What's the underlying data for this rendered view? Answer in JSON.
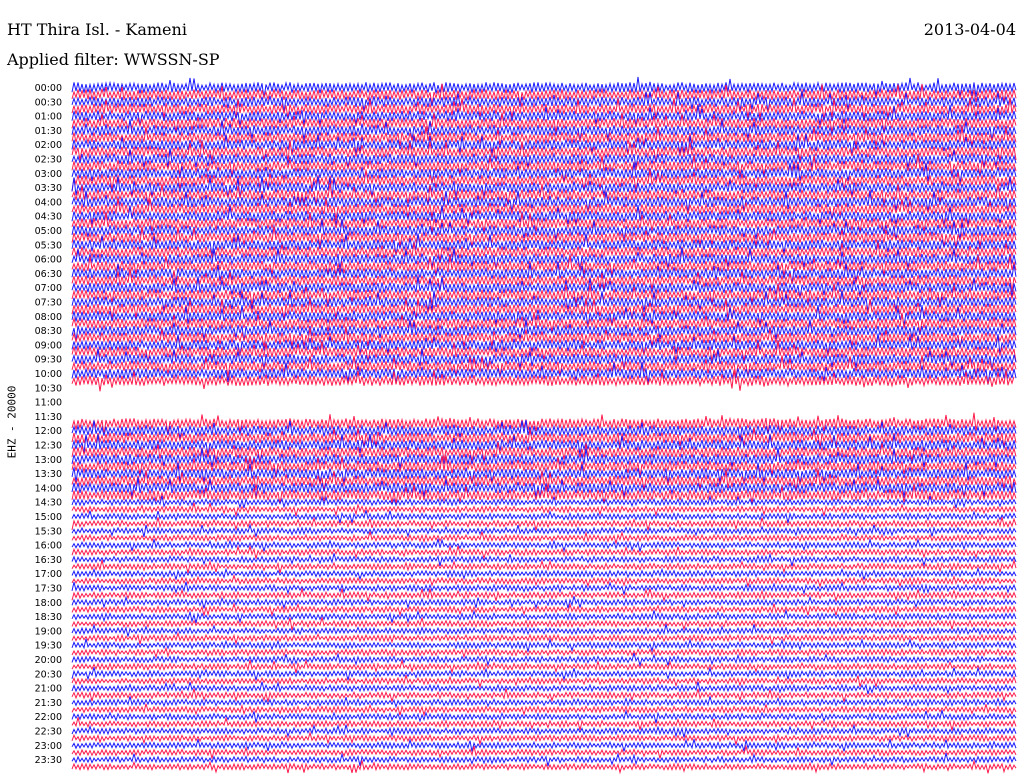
{
  "header": {
    "station": "HT Thira Isl. - Kameni",
    "date": "2013-04-04",
    "filter": "Applied filter: WWSSN-SP",
    "channel": "EHZ - 20000"
  },
  "chart_data": {
    "type": "line",
    "chart_kind": "helicorder (seismogram drum plot)",
    "station": "HT Thira Isl. - Kameni",
    "date": "2013-04-04",
    "filter": "WWSSN-SP",
    "ylabel": "EHZ - 20000",
    "row_interval_minutes": 15,
    "tick_labels": [
      "00:00",
      "00:30",
      "01:00",
      "01:30",
      "02:00",
      "02:30",
      "03:00",
      "03:30",
      "04:00",
      "04:30",
      "05:00",
      "05:30",
      "06:00",
      "06:30",
      "07:00",
      "07:30",
      "08:00",
      "08:30",
      "09:00",
      "09:30",
      "10:00",
      "10:30",
      "11:00",
      "11:30",
      "12:00",
      "12:30",
      "13:00",
      "13:30",
      "14:00",
      "14:30",
      "15:00",
      "15:30",
      "16:00",
      "16:30",
      "17:00",
      "17:30",
      "18:00",
      "18:30",
      "19:00",
      "19:30",
      "20:00",
      "20:30",
      "21:00",
      "21:30",
      "22:00",
      "22:30",
      "23:00",
      "23:30"
    ],
    "trace_colors": [
      "#1a1aff",
      "#ff1a4d"
    ],
    "color_order": "alternating by row: blue, red",
    "rows": 96,
    "gap": {
      "from": "10:30",
      "to": "11:45"
    },
    "noisy_period": {
      "from": "00:00",
      "to": "14:30"
    }
  }
}
